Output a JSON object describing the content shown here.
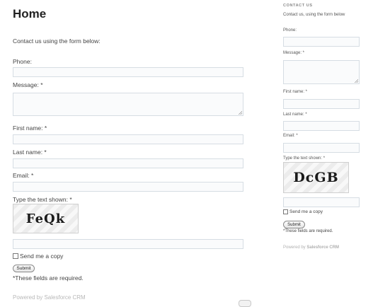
{
  "main": {
    "title": "Home",
    "intro": "Contact us using the form below:",
    "phone_label": "Phone:",
    "message_label": "Message: *",
    "first_name_label": "First name: *",
    "last_name_label": "Last name: *",
    "email_label": "Email: *",
    "captcha_label": "Type the text shown: *",
    "captcha_text": "FeQk",
    "send_copy_label": "Send me a copy",
    "submit_label": "Submit",
    "required_note": "*These fields are required.",
    "powered_prefix": "Powered by ",
    "powered_brand": "Salesforce CRM"
  },
  "sidebar": {
    "title": "CONTACT US",
    "intro": "Contact us, using the form below",
    "phone_label": "Phone:",
    "message_label": "Message: *",
    "first_name_label": "First name: *",
    "last_name_label": "Last name: *",
    "email_label": "Email: *",
    "captcha_label": "Type the text shown: *",
    "captcha_text": "DcGB",
    "send_copy_label": "Send me a copy",
    "submit_label": "Submit",
    "required_note": "*These fields are required.",
    "powered_prefix": "Powered by ",
    "powered_brand": "Salesforce CRM"
  }
}
